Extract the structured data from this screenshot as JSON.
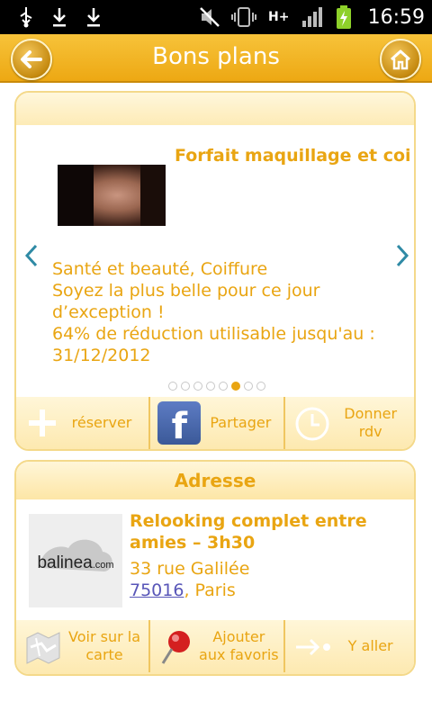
{
  "status_bar": {
    "time": "16:59",
    "network_type": "H+",
    "icons": [
      "usb-icon",
      "download-icon",
      "download-icon",
      "mute-icon",
      "vibrate-icon",
      "hplus-icon",
      "signal-icon",
      "battery-charging-icon"
    ]
  },
  "header": {
    "title": "Bons plans",
    "back_icon": "back-arrow-icon",
    "home_icon": "home-icon"
  },
  "deal": {
    "title": "Forfait maquillage et coiffure spécial mariag",
    "category": "Santé et beauté, Coiffure",
    "description_line1": "Soyez la plus belle pour ce jour d’exception !",
    "description_line2": "64% de réduction utilisable jusqu'au : 31/12/2012",
    "pagination": {
      "total": 8,
      "active_index": 5
    },
    "actions": {
      "reserve": "réserver",
      "share": "Partager",
      "rdv": "Donner rdv"
    }
  },
  "address": {
    "header": "Adresse",
    "logo_text": "balinea",
    "logo_suffix": ".com",
    "title": "Relooking complet entre amies – 3h30",
    "street": "33 rue Galilée",
    "postal_code": "75016",
    "city": ", Paris",
    "actions": {
      "map": "Voir sur la carte",
      "favorites": "Ajouter aux favoris",
      "go": "Y aller"
    }
  },
  "colors": {
    "accent": "#e9a512",
    "header": "#f2b526",
    "link": "#5856b8",
    "arrow": "#2f8aa5"
  }
}
